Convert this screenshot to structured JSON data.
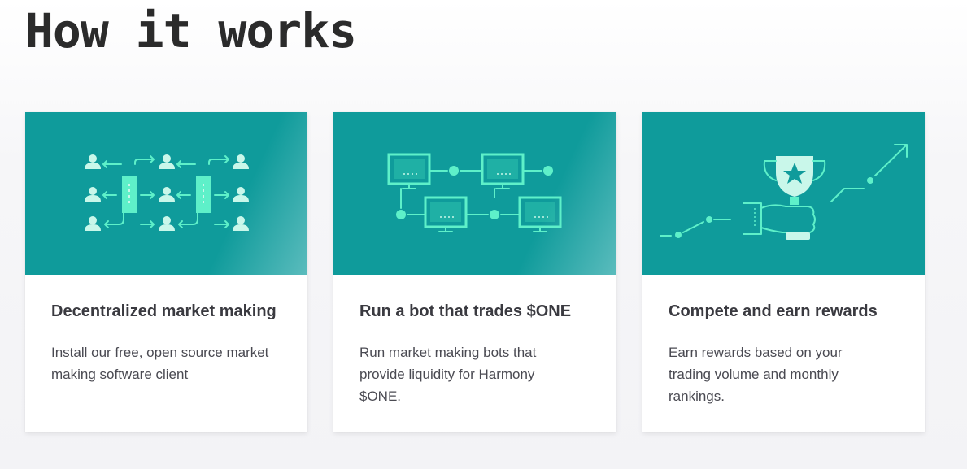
{
  "page": {
    "title": "How it works"
  },
  "cards": [
    {
      "icon": "decentralized-network-icon",
      "title": "Decentralized market making",
      "text": "Install our free, open source market making software client"
    },
    {
      "icon": "trading-bot-network-icon",
      "title": "Run a bot that trades $ONE",
      "text": "Run market making bots that provide liquidity for Harmony $ONE."
    },
    {
      "icon": "trophy-rewards-icon",
      "title": "Compete and earn rewards",
      "text": "Earn rewards based on your trading volume and monthly rankings."
    }
  ],
  "colors": {
    "card_header": "#0f9b9b",
    "icon_accent": "#5ef0c9",
    "title_text": "#2b2b2b"
  }
}
